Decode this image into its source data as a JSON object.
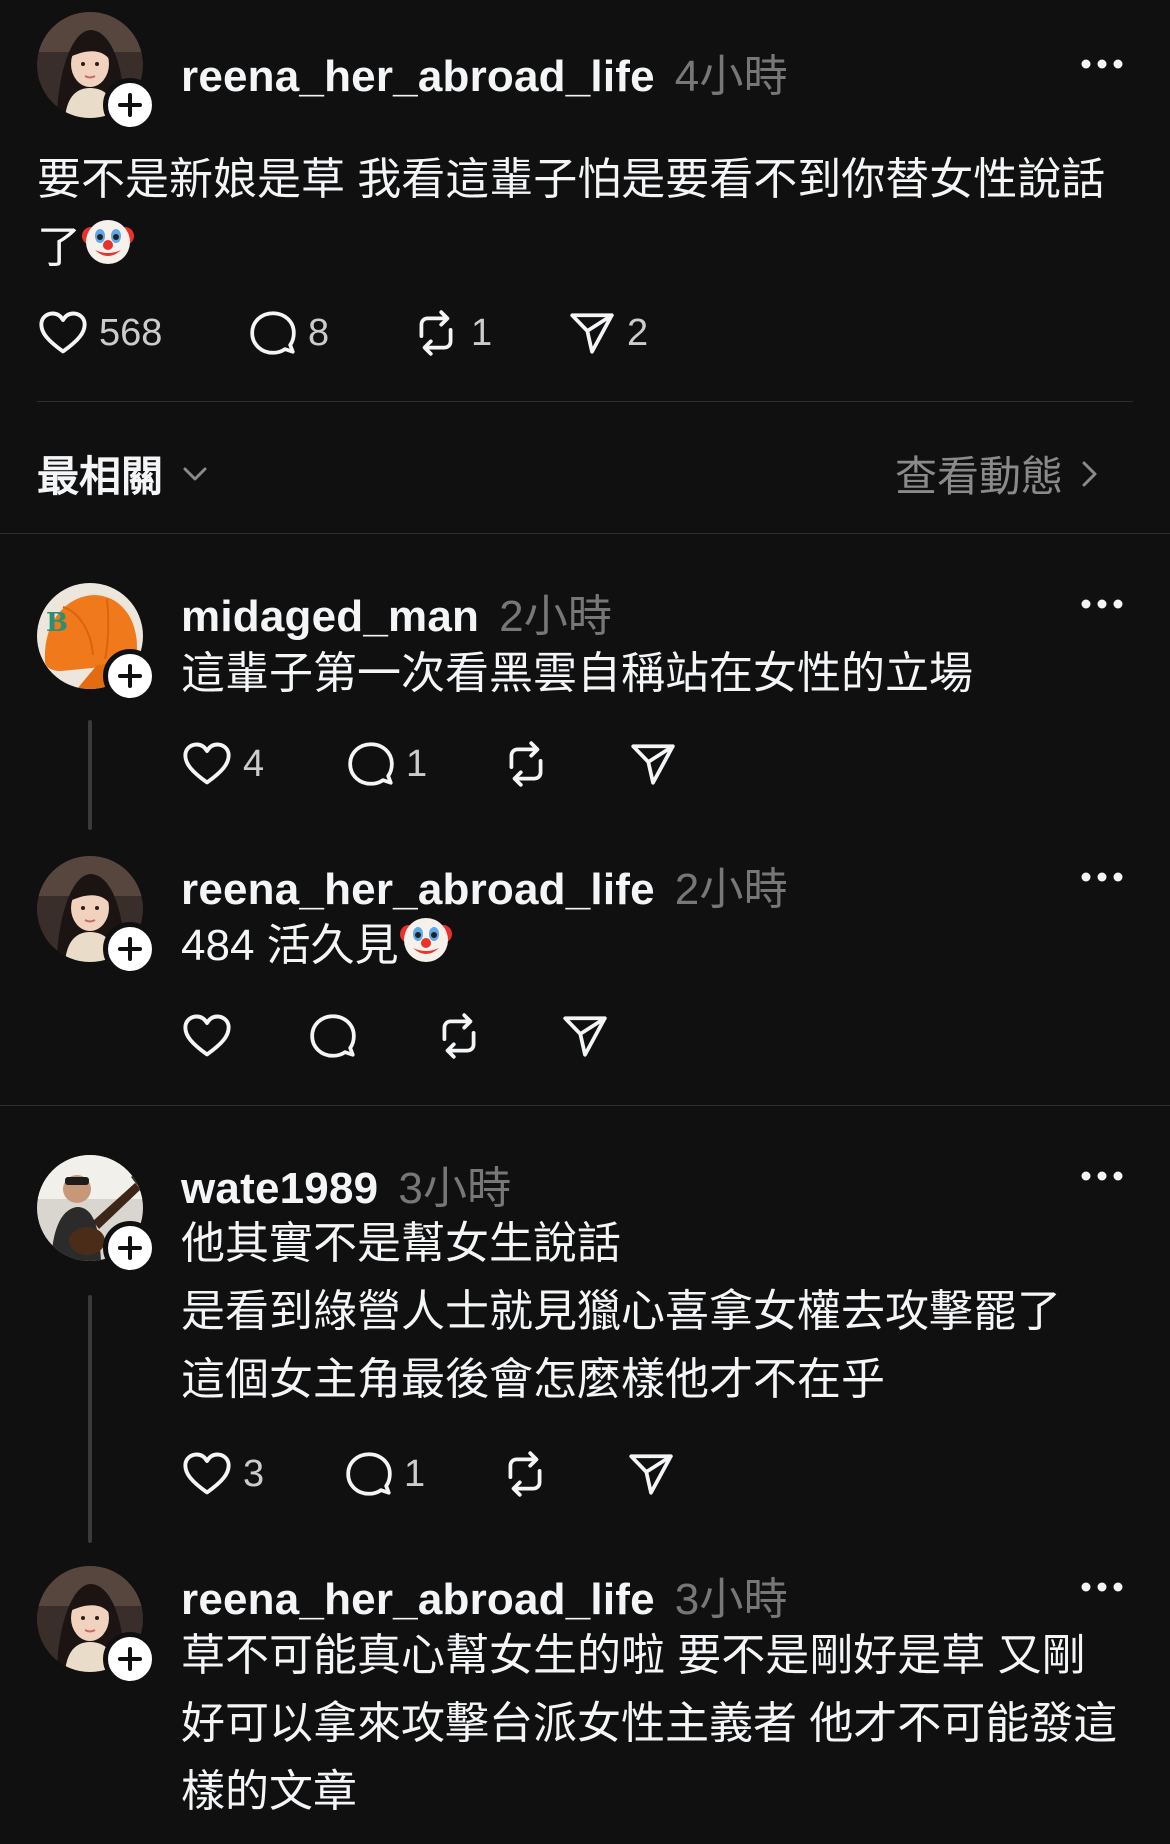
{
  "post": {
    "username": "reena_her_abroad_life",
    "time": "4小時",
    "text_line1": "要不是新娘是草 我看這輩子怕是要看不到你替女性說話",
    "text_line2": "了",
    "likes": "568",
    "comments": "8",
    "reposts": "1",
    "shares": "2"
  },
  "sort": {
    "label": "最相關",
    "activity": "查看動態"
  },
  "replies": [
    {
      "username": "midaged_man",
      "time": "2小時",
      "lines": [
        "這輩子第一次看黑雲自稱站在女性的立場"
      ],
      "likes": "4",
      "comments": "1"
    },
    {
      "username": "reena_her_abroad_life",
      "time": "2小時",
      "lines": [
        "484 活久見"
      ]
    },
    {
      "username": "wate1989",
      "time": "3小時",
      "lines": [
        "他其實不是幫女生說話",
        "是看到綠營人士就見獵心喜拿女權去攻擊罷了",
        "這個女主角最後會怎麼樣他才不在乎"
      ],
      "likes": "3",
      "comments": "1"
    },
    {
      "username": "reena_her_abroad_life",
      "time": "3小時",
      "lines": [
        "草不可能真心幫女生的啦 要不是剛好是草 又剛",
        "好可以拿來攻擊台派女性主義者 他才不可能發這",
        "樣的文章"
      ]
    }
  ],
  "icons": {
    "like": "heart-icon",
    "comment": "comment-bubble-icon",
    "repost": "repost-icon",
    "share": "send-icon",
    "more": "more-dots-icon",
    "follow": "plus-icon",
    "emoji": "clown-face-emoji"
  }
}
